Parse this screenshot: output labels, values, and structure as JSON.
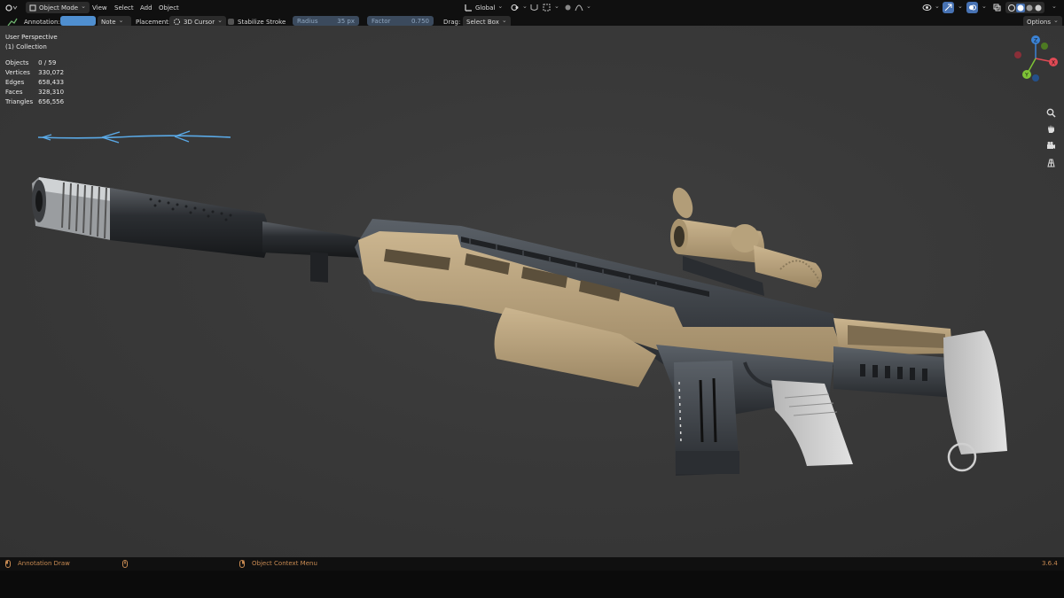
{
  "header": {
    "mode_label": "Object Mode",
    "menus": [
      "View",
      "Select",
      "Add",
      "Object"
    ],
    "orientation_label": "Global",
    "options_label": "Options"
  },
  "tool_settings": {
    "annotation_label": "Annotation:",
    "note_label": "Note",
    "placement_label": "Placement:",
    "placement_value": "3D Cursor",
    "stabilize_label": "Stabilize Stroke",
    "radius_label": "Radius",
    "radius_value": "35 px",
    "factor_label": "Factor",
    "factor_value": "0.750",
    "drag_label": "Drag:",
    "drag_value": "Select Box"
  },
  "viewport": {
    "view_name": "User Perspective",
    "collection": "(1) Collection",
    "stats": [
      {
        "label": "Objects",
        "value": "0 / 59"
      },
      {
        "label": "Vertices",
        "value": "330,072"
      },
      {
        "label": "Edges",
        "value": "658,433"
      },
      {
        "label": "Faces",
        "value": "328,310"
      },
      {
        "label": "Triangles",
        "value": "656,556"
      }
    ],
    "gizmo_axes": [
      "Z",
      "Y",
      "X"
    ]
  },
  "statusbar": {
    "left_action": "Annotation Draw",
    "middle_action": "Object Context Menu",
    "version": "3.6.4"
  },
  "colors": {
    "annotation_swatch": "#4f8fd0",
    "annotation_stroke": "#5aa9e6",
    "tan": "#b29d78",
    "gun_dark": "#34373c",
    "axis_x": "#e04a55",
    "axis_y": "#7ec436",
    "axis_z": "#3b83d6"
  }
}
